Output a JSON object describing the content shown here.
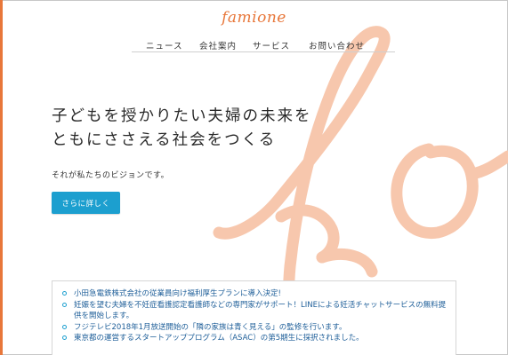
{
  "brand": {
    "logo_text": "famione",
    "accent_color": "#e8773a",
    "deco_color": "#f7c7ad"
  },
  "nav": {
    "items": [
      {
        "label": "ニュース"
      },
      {
        "label": "会社案内"
      },
      {
        "label": "サービス"
      },
      {
        "label": "お問い合わせ"
      }
    ]
  },
  "hero": {
    "headline_line1": "子どもを授かりたい夫婦の未来を",
    "headline_line2": "ともにささえる社会をつくる",
    "subtext": "それが私たちのビジョンです。",
    "cta_label": "さらに詳しく",
    "cta_color": "#1c9fcf"
  },
  "news": {
    "items": [
      {
        "text": "小田急電鉄株式会社の従業員向け福利厚生プランに導入決定!"
      },
      {
        "text": "妊娠を望む夫婦を不妊症看護認定看護師などの専門家がサポート！LINEによる妊活チャットサービスの無料提供を開始します。"
      },
      {
        "text": "フジテレビ2018年1月放送開始の「隣の家族は青く見える」の監修を行います。"
      },
      {
        "text": "東京都の運営するスタートアッププログラム（ASAC）の第5期生に採択されました。"
      }
    ]
  }
}
